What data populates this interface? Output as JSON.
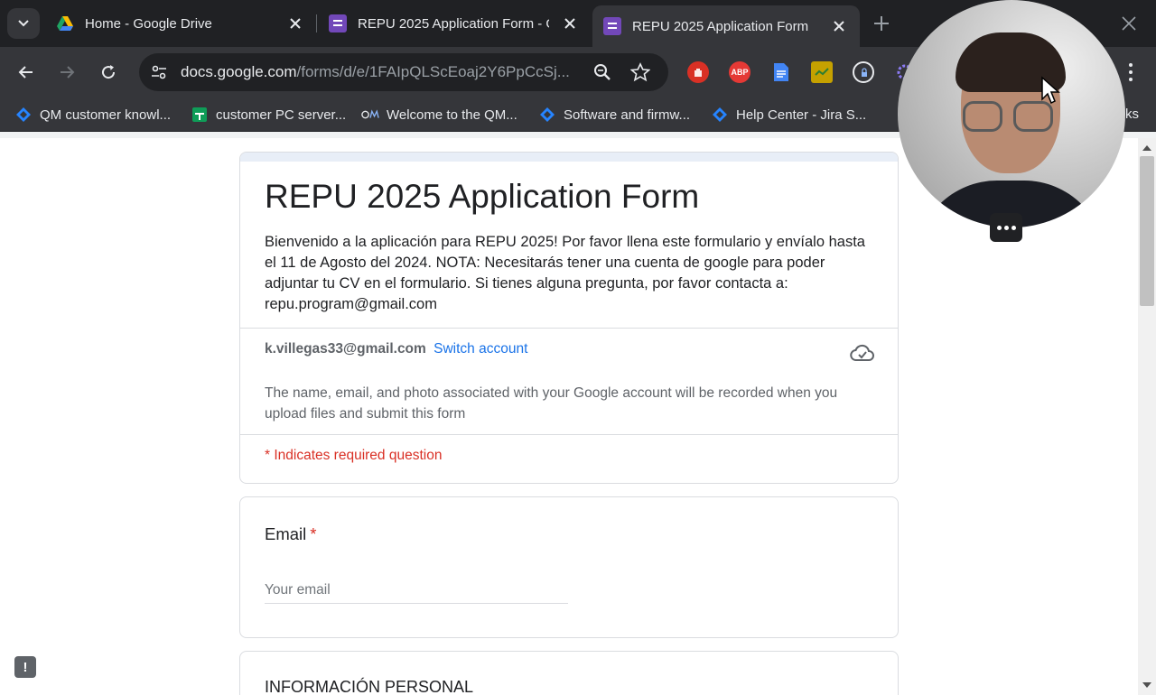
{
  "browser": {
    "tabs": [
      {
        "title": "Home - Google Drive",
        "active": false
      },
      {
        "title": "REPU 2025 Application Form - G",
        "active": false
      },
      {
        "title": "REPU 2025 Application Form",
        "active": true
      }
    ],
    "url_host": "docs.google.com",
    "url_path": "/forms/d/e/1FAIpQLScEoaj2Y6PpCcSj...",
    "bookmarks": [
      "QM customer knowl...",
      "customer PC server...",
      "Welcome to the QM...",
      "Software and firmw...",
      "Help Center - Jira S..."
    ],
    "bookmarks_more": "ks",
    "extensions": {
      "abp_label": "ABP"
    }
  },
  "form": {
    "title": "REPU 2025 Application Form",
    "description": "Bienvenido a la aplicación para REPU 2025! Por favor llena este formulario y envíalo hasta el 11 de Agosto del 2024. NOTA: Necesitarás tener una cuenta de google para poder adjuntar tu CV en el formulario. Si tienes alguna pregunta, por favor contacta a: repu.program@gmail.com",
    "account_email": "k.villegas33@gmail.com",
    "switch_account": "Switch account",
    "notice": "The name, email, and photo associated with your Google account will be recorded when you upload files and submit this form",
    "required_note": "* Indicates required question",
    "email_question": {
      "label": "Email",
      "required_mark": "*",
      "placeholder": "Your email",
      "value": ""
    },
    "section_title": "INFORMACIÓN PERSONAL"
  },
  "colors": {
    "accent": "#1a73e8",
    "required": "#d93025",
    "forms_purple": "#7248b9"
  },
  "report_button_label": "!"
}
